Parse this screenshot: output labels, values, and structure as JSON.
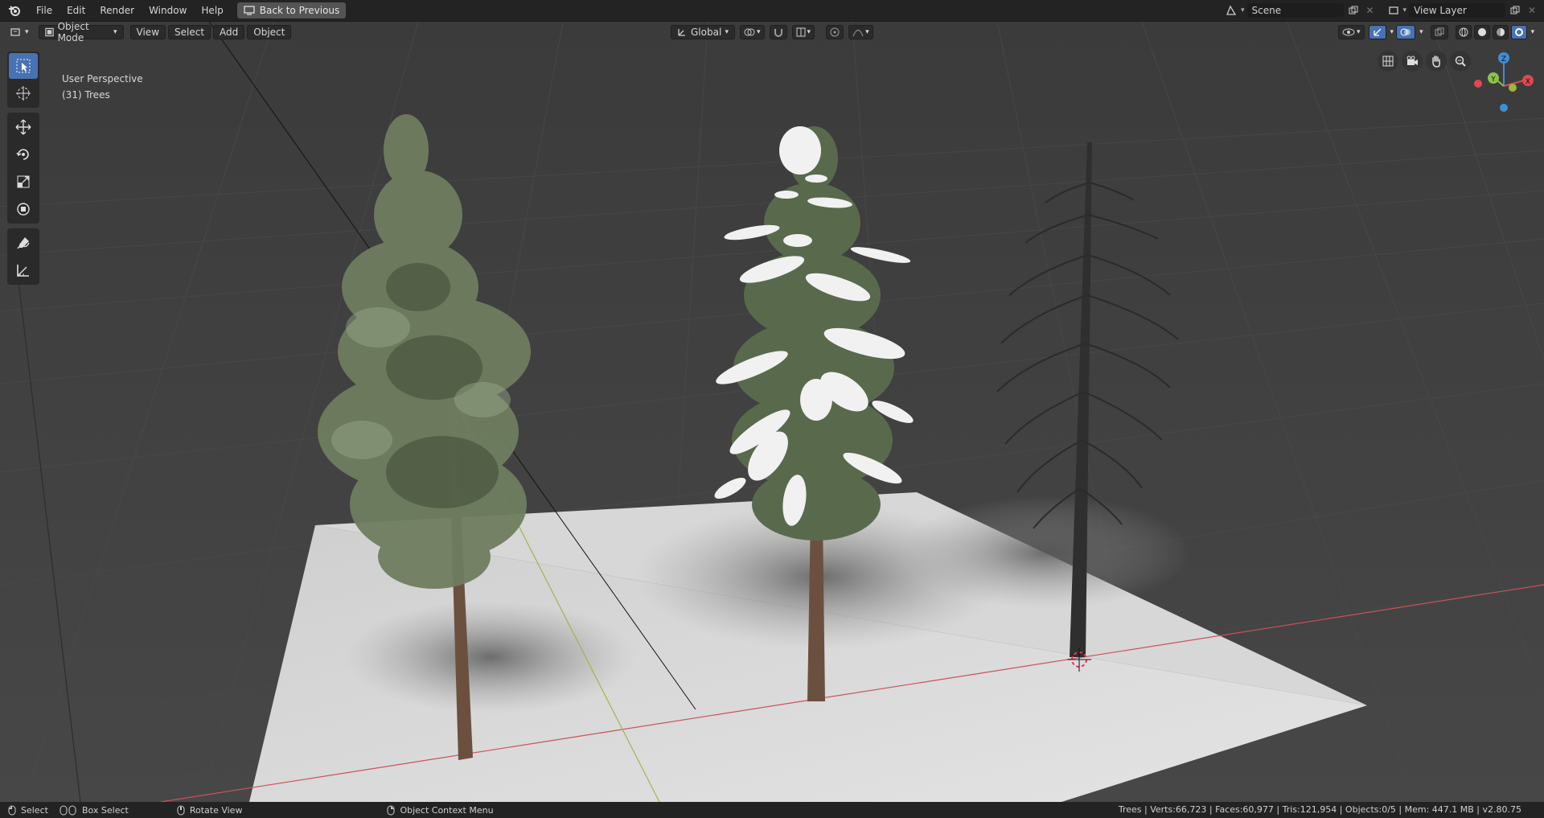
{
  "menu": {
    "items": [
      "File",
      "Edit",
      "Render",
      "Window",
      "Help"
    ],
    "back_label": "Back to Previous",
    "scene_name": "Scene",
    "view_layer": "View Layer"
  },
  "viewport_header": {
    "mode": "Object Mode",
    "menus": [
      "View",
      "Select",
      "Add",
      "Object"
    ],
    "orientation": "Global"
  },
  "overlay": {
    "view_name": "User Perspective",
    "collection": "(31) Trees"
  },
  "statusbar": {
    "select": "Select",
    "box_select": "Box Select",
    "rotate_view": "Rotate View",
    "context_menu": "Object Context Menu",
    "stats": "Trees | Verts:66,723 | Faces:60,977 | Tris:121,954 | Objects:0/5 | Mem: 447.1 MB | v2.80.75"
  },
  "gizmo": {
    "x": "X",
    "y": "Y",
    "z": "Z"
  },
  "colors": {
    "accent": "#4772b3",
    "x_axis": "#e0484f",
    "y_axis": "#8bc34a",
    "z_axis": "#3d8fd6"
  },
  "icons": {
    "toolbar": [
      "select-box-icon",
      "cursor-icon",
      "move-icon",
      "rotate-icon",
      "scale-icon",
      "transform-icon",
      "annotate-icon",
      "measure-icon"
    ],
    "nav": [
      "grid-view-icon",
      "camera-icon",
      "pan-hand-icon",
      "zoom-icon"
    ]
  }
}
